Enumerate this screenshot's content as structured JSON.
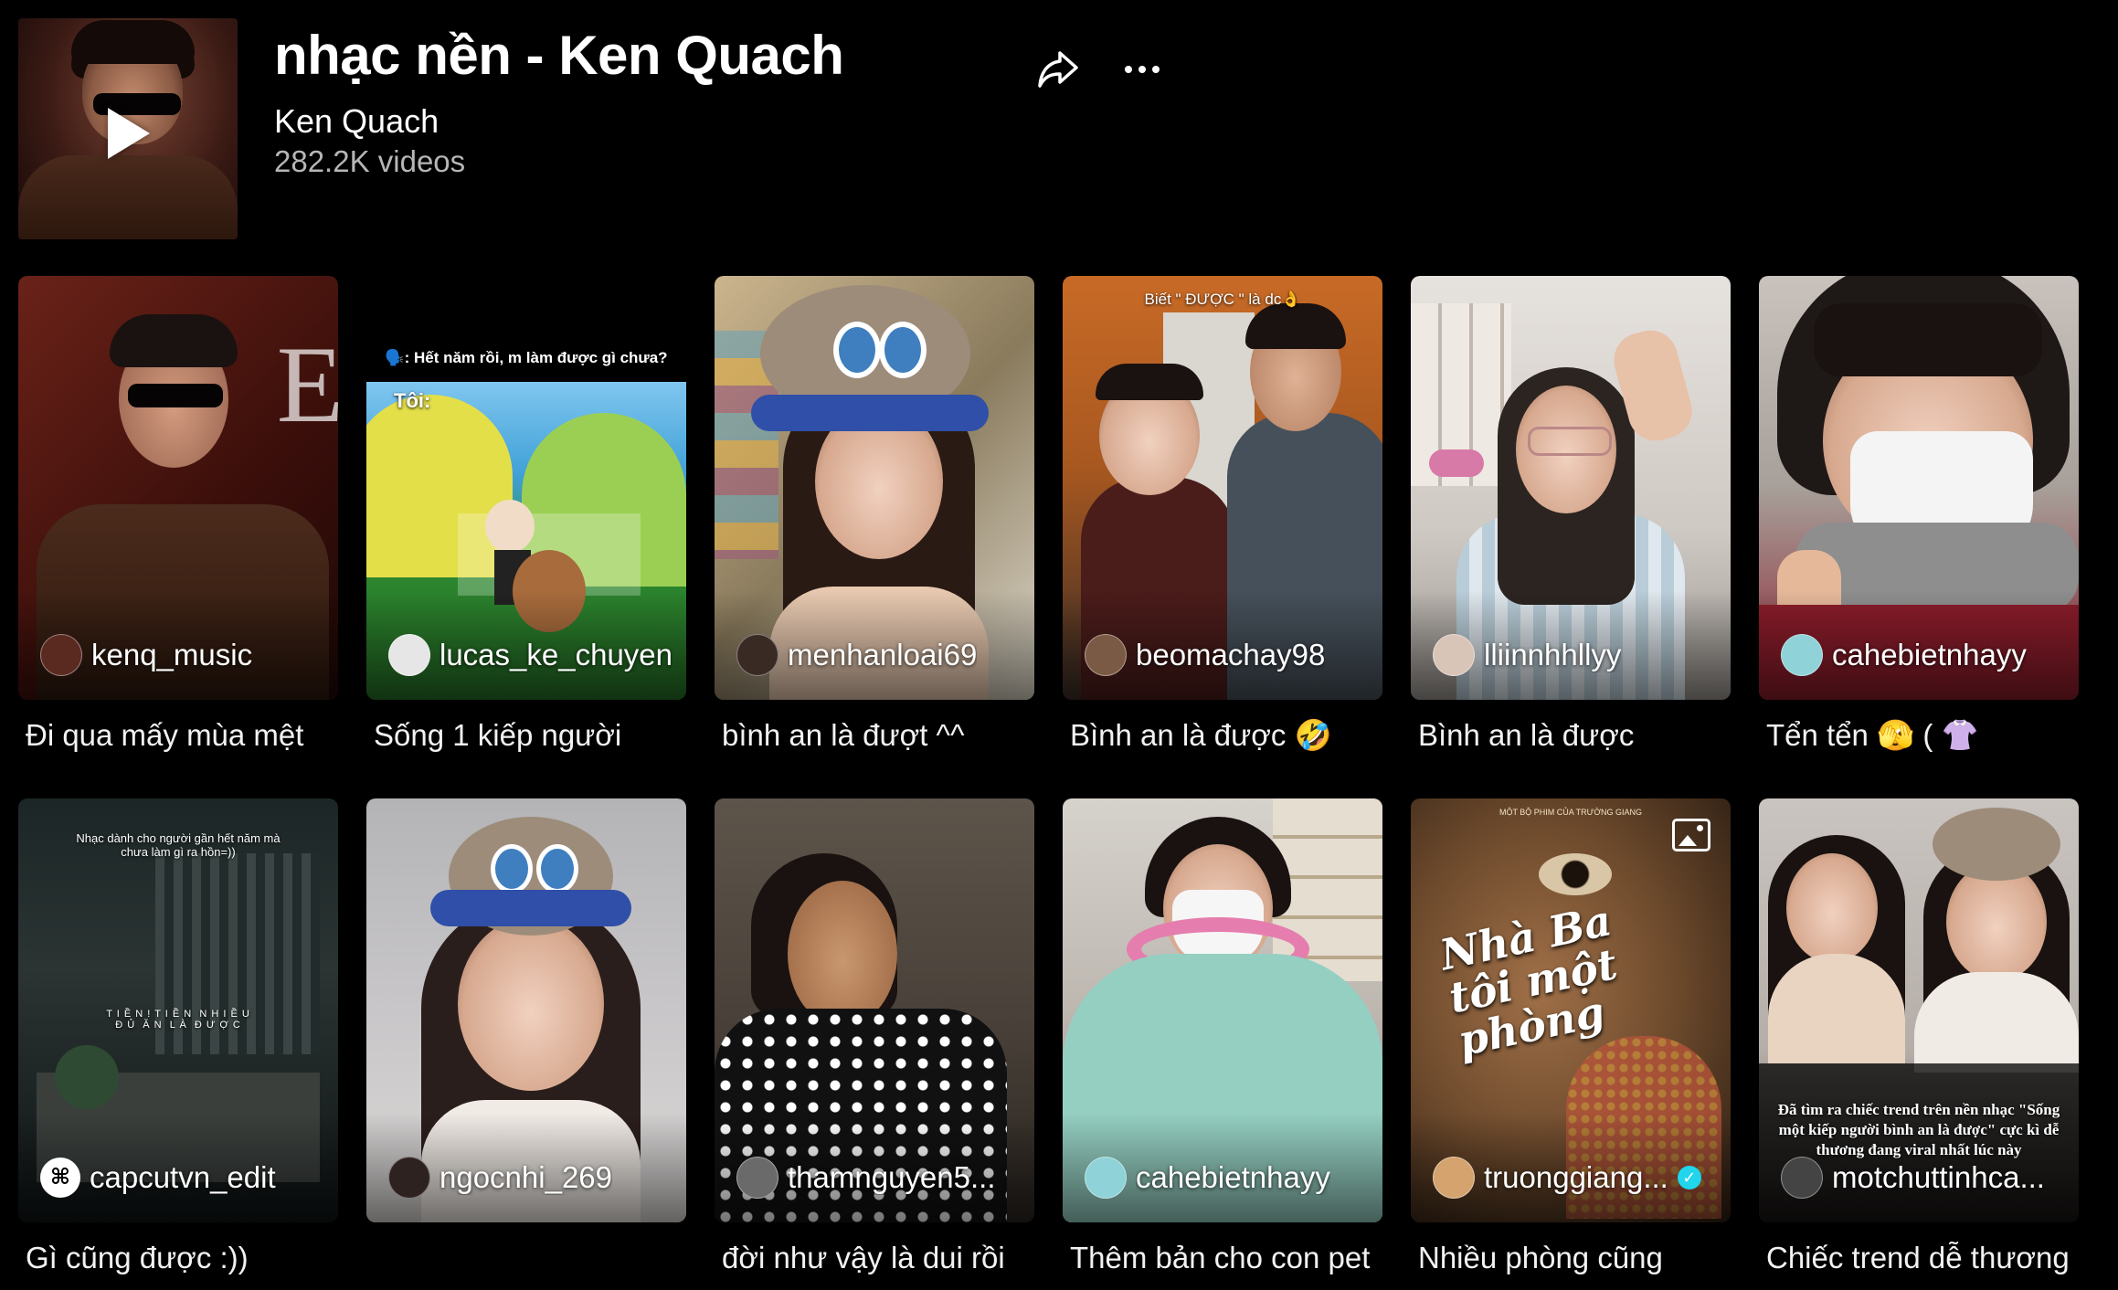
{
  "header": {
    "title": "nhạc nền - Ken Quach",
    "artist": "Ken Quach",
    "video_count": "282.2K videos",
    "share_icon": "share-arrow-icon",
    "more_icon": "more-horizontal-icon",
    "play_icon": "play-icon"
  },
  "videos": [
    {
      "username": "kenq_music",
      "caption": "Đi qua mấy mùa mệt",
      "verified": false
    },
    {
      "username": "lucas_ke_chuyen",
      "caption": "Sống 1 kiếp người",
      "overlay_top": "🗣️: Hết năm rồi, m làm được gì chưa?",
      "overlay_sub": "Tôi:",
      "verified": false
    },
    {
      "username": "menhanloai69",
      "caption": "bình an là đượt ^^",
      "verified": false
    },
    {
      "username": "beomachay98",
      "caption": "Bình an là được 🤣",
      "overlay_top": "Biết \" ĐƯỢC \" là dc👌",
      "verified": false
    },
    {
      "username": "lliinnhhllyy",
      "caption": "Bình an là được",
      "verified": false
    },
    {
      "username": "cahebietnhayy",
      "caption": "Tển tển 🫣 ( 👚",
      "verified": false
    },
    {
      "username": "capcutvn_edit",
      "caption": "Gì cũng được :))",
      "overlay_top": "Nhạc dành cho người gần hết năm mà chưa làm gì ra hồn=))",
      "overlay_mid": "T I Ề N ! T I Ề N  N H I Ề U\nĐ Ủ  Ă N  L À  Đ Ư Ợ C",
      "verified": false
    },
    {
      "username": "ngocnhi_269",
      "caption": "",
      "verified": false
    },
    {
      "username": "thamnguyen5...",
      "caption": "đời như vậy là dui rồi",
      "verified": false
    },
    {
      "username": "cahebietnhayy",
      "caption": "Thêm bản cho con pet",
      "verified": false
    },
    {
      "username": "truonggiang...",
      "caption": "Nhiều phòng cũng",
      "overlay_title": "Nhà Ba tôi một phòng",
      "overlay_small": "MỘT BỘ PHIM CỦA TRƯỜNG GIANG",
      "verified": true
    },
    {
      "username": "motchuttinhca...",
      "caption": "Chiếc trend dễ thương",
      "overlay_bottom": "Đã tìm ra chiếc trend trên nền nhạc \"Sống một kiếp người bình an là được\" cực kì dễ thương đang viral nhất lúc này",
      "verified": false
    }
  ],
  "colors": {
    "background": "#000000",
    "text_primary": "#ffffff",
    "text_secondary": "#b6b6b6",
    "verified": "#20d5ec"
  }
}
